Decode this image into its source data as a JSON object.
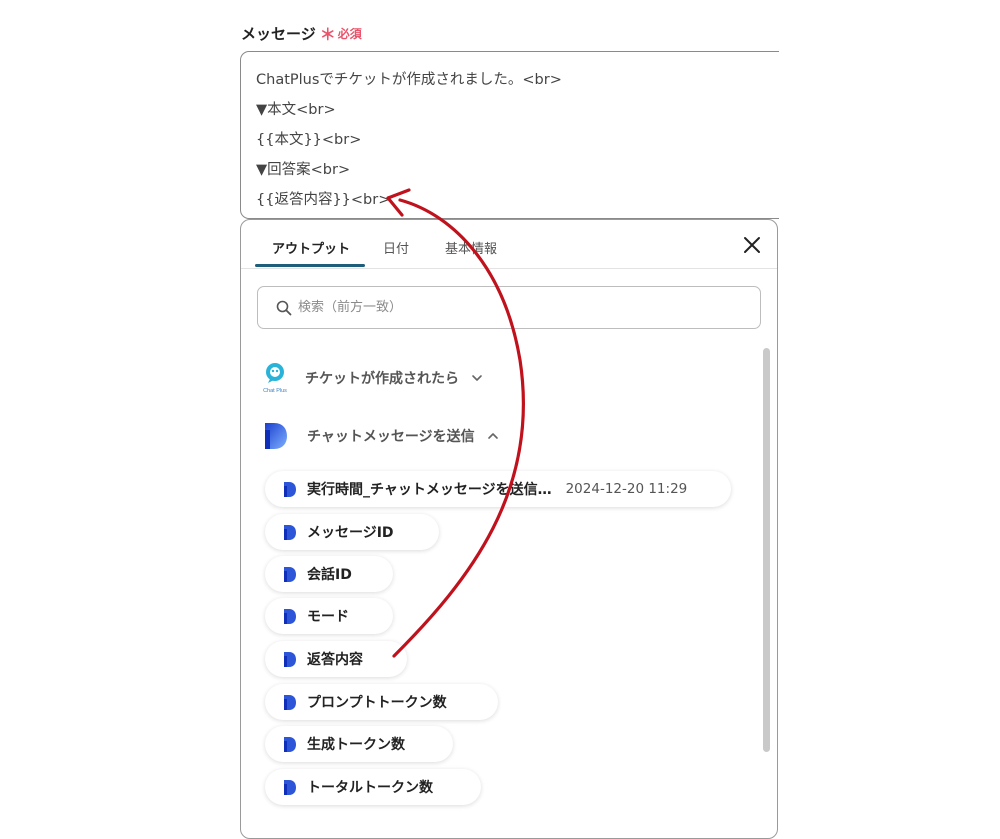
{
  "field": {
    "label": "メッセージ",
    "required_mark": "＊",
    "required_text": "必須",
    "lines": [
      "ChatPlusでチケットが作成されました。<br>",
      "▼本文<br>",
      "{{本文}}<br>",
      "▼回答案<br>",
      "{{返答内容}}<br>"
    ]
  },
  "panel": {
    "tabs": [
      {
        "label": "アウトプット"
      },
      {
        "label": "日付"
      },
      {
        "label": "基本情報"
      }
    ],
    "search_placeholder": "検索（前方一致）",
    "sections": [
      {
        "title": "チケットが作成されたら",
        "logo_text": "Chat Plus"
      },
      {
        "title": "チャットメッセージを送信"
      }
    ],
    "items": [
      {
        "label": "実行時間_チャットメッセージを送信…",
        "value": "2024-12-20 11:29"
      },
      {
        "label": "メッセージID"
      },
      {
        "label": "会話ID"
      },
      {
        "label": "モード"
      },
      {
        "label": "返答内容"
      },
      {
        "label": "プロンプトトークン数"
      },
      {
        "label": "生成トークン数"
      },
      {
        "label": "トータルトークン数"
      }
    ]
  },
  "colors": {
    "accent": "#1d5f7a",
    "required": "#e8546b",
    "arrow": "#c0121d",
    "brand_blue": "#2d55d8"
  },
  "icons": {
    "search": "search-icon",
    "close": "close-icon",
    "chevron_down": "chevron-down-icon",
    "chevron_up": "chevron-up-icon",
    "app_logo": "yoom-logo-icon",
    "chatplus_logo": "chatplus-logo-icon"
  }
}
